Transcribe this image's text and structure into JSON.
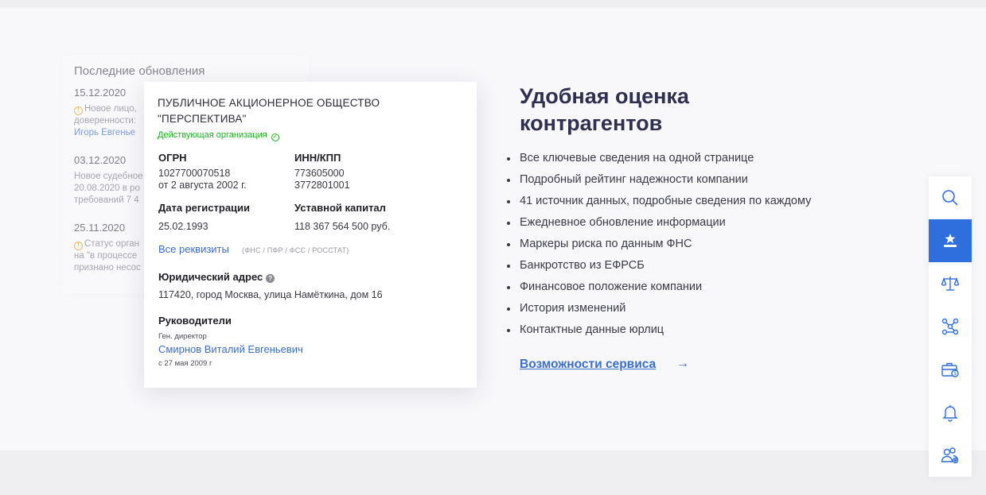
{
  "updates": {
    "title": "Последние обновления",
    "items": [
      {
        "date": "15.12.2020",
        "line1": "Новое лицо,",
        "line2": "доверенности:",
        "line3": "Игорь Евгенье"
      },
      {
        "date": "03.12.2020",
        "line1": "Новое судебное",
        "line2": "20.08.2020 в ро",
        "line3": "требований 7 4"
      },
      {
        "date": "25.11.2020",
        "line1": "Статус орган",
        "line2": "на \"в процессе",
        "line3": "признано несос"
      }
    ]
  },
  "company": {
    "name": "ПУБЛИЧНОЕ АКЦИОНЕРНОЕ ОБЩЕСТВО \"ПЕРСПЕКТИВА\"",
    "status": "Действующая организация",
    "ogrn_label": "ОГРН",
    "ogrn_value": "1027700070518",
    "ogrn_date": "от 2 августа 2002 г.",
    "inn_label": "ИНН/КПП",
    "inn_value": "773605000",
    "kpp_value": "3772801001",
    "reg_label": "Дата регистрации",
    "reg_value": "25.02.1993",
    "capital_label": "Уставной капитал",
    "capital_value": "118 367 564 500 руб.",
    "requisites_link": "Все реквизиты",
    "requisites_note": "(ФНС / ПФР / ФСС / РОССТАТ)",
    "address_label": "Юридический адрес",
    "address_value": "117420, город Москва, улица Намёткина, дом 16",
    "managers_label": "Руководители",
    "manager_role": "Ген. директор",
    "manager_name": "Смирнов Виталий Евгеньевич",
    "manager_since": "с 27 мая 2009 г"
  },
  "promo": {
    "heading": "Удобная оценка контрагентов",
    "features": [
      "Все ключевые сведения на одной странице",
      "Подробный рейтинг надежности компании",
      "41 источник данных, подробные сведения по каждому",
      "Ежедневное обновление информации",
      "Маркеры риска по данным ФНС",
      "Банкротство из ЕФРСБ",
      "Финансовое положение компании",
      "История изменений",
      "Контактные данные юрлиц"
    ],
    "more_link": "Возможности сервиса",
    "arrow": "→"
  },
  "toolbar": {
    "accent": "#2f6fdd",
    "buttons": [
      "search-icon",
      "company-star-icon",
      "scales-icon",
      "network-icon",
      "briefcase-money-icon",
      "bell-icon",
      "people-gear-icon"
    ]
  }
}
